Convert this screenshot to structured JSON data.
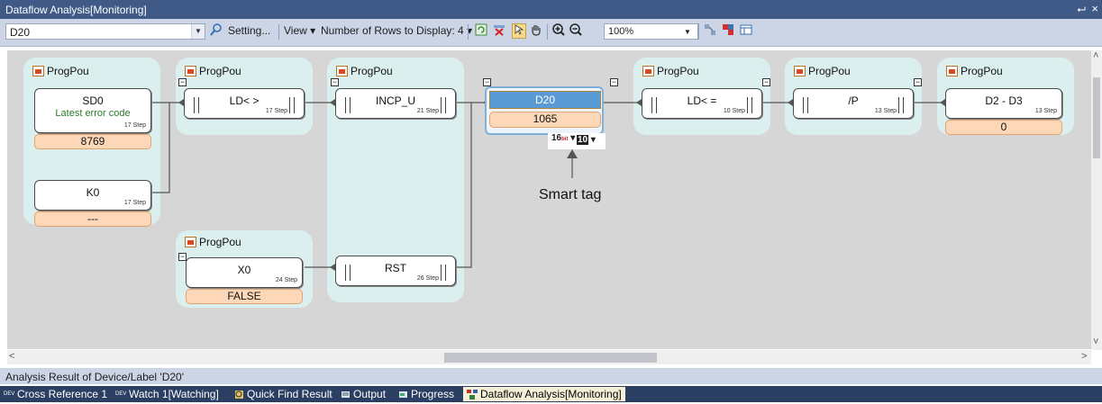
{
  "window": {
    "title": "Dataflow Analysis[Monitoring]",
    "pin_glyph": "⮠",
    "close_glyph": "×"
  },
  "toolbar": {
    "device_value": "D20",
    "setting_label": "Setting...",
    "view_label": "View",
    "rows_label": "Number of Rows to Display: 4",
    "zoom_value": "100%"
  },
  "groups": [
    {
      "title": "ProgPou"
    },
    {
      "title": "ProgPou"
    },
    {
      "title": "ProgPou"
    },
    {
      "title": "ProgPou"
    },
    {
      "title": "ProgPou"
    },
    {
      "title": "ProgPou"
    },
    {
      "title": "ProgPou"
    }
  ],
  "nodes": {
    "sd0": {
      "name": "SD0",
      "comment": "Latest error code",
      "step": "17 Step",
      "value": "8769"
    },
    "k0": {
      "name": "K0",
      "step": "17 Step",
      "value": "---"
    },
    "ld_ne": {
      "name": "LD< >",
      "step": "17 Step"
    },
    "x0": {
      "name": "X0",
      "step": "24 Step",
      "value": "FALSE"
    },
    "incp": {
      "name": "INCP_U",
      "step": "21 Step"
    },
    "rst": {
      "name": "RST",
      "step": "26 Step"
    },
    "d20": {
      "name": "D20",
      "value": "1065"
    },
    "ld_le": {
      "name": "LD< =",
      "step": "10 Step"
    },
    "p": {
      "name": "/P",
      "step": "13 Step"
    },
    "d2d3": {
      "name": "D2 - D3",
      "step": "13 Step",
      "value": "0"
    }
  },
  "smart_tag": {
    "bit_label": "16",
    "bit_sub": "bit",
    "fmt_label": "10",
    "caption": "Smart tag"
  },
  "status": {
    "text": "Analysis Result of Device/Label 'D20'"
  },
  "tabs": [
    {
      "label": "Cross Reference 1",
      "icon": "DEV"
    },
    {
      "label": "Watch 1[Watching]",
      "icon": "DEV"
    },
    {
      "label": "Quick Find Result",
      "icon": ""
    },
    {
      "label": "Output",
      "icon": ""
    },
    {
      "label": "Progress",
      "icon": ""
    },
    {
      "label": "Dataflow Analysis[Monitoring]",
      "icon": ""
    }
  ],
  "colors": {
    "title_bar": "#3f5a86",
    "toolbar": "#ccd5e6",
    "group_bg": "#dcefef",
    "value_bg": "#fcd8b8",
    "selected_node": "#5b9bd5"
  }
}
